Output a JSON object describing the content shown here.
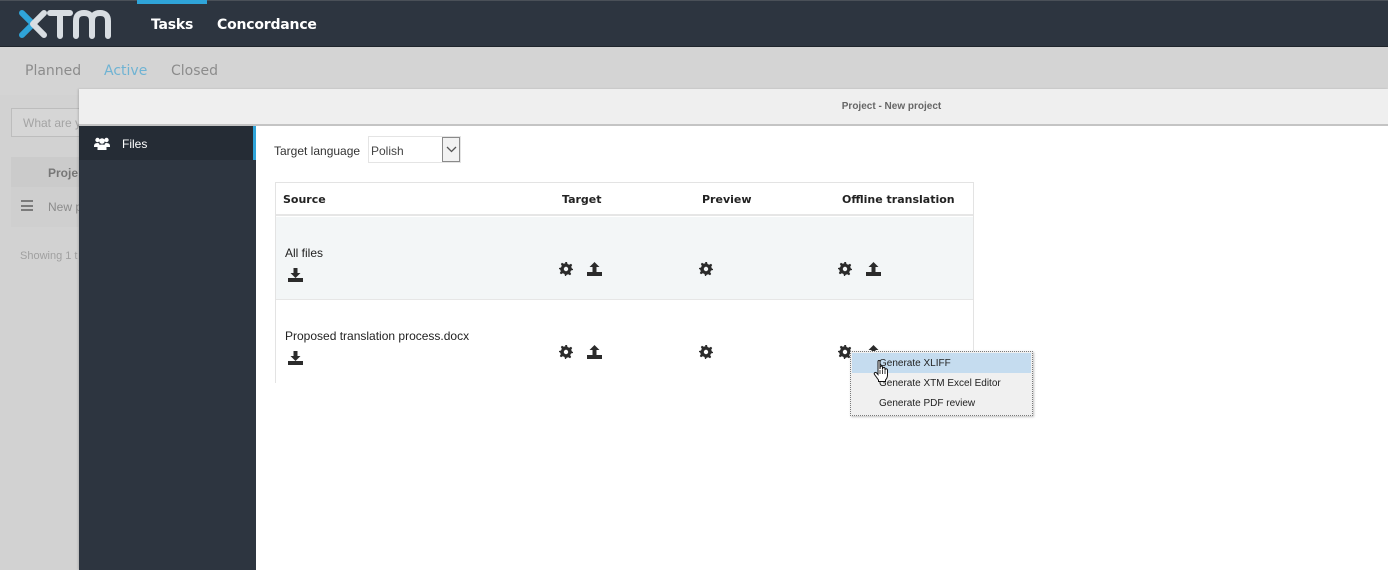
{
  "app": {
    "logo_text": "XTM",
    "colors": {
      "accent": "#2fa4d9",
      "topbar": "#2d3540",
      "sidebar": "#2d3540",
      "menu_highlight": "#c5dcef"
    }
  },
  "topnav": {
    "tabs": [
      {
        "label": "Tasks",
        "active": true
      },
      {
        "label": "Concordance",
        "active": false
      }
    ]
  },
  "subnav": {
    "tabs": [
      {
        "label": "Planned",
        "active": false
      },
      {
        "label": "Active",
        "active": true
      },
      {
        "label": "Closed",
        "active": false
      }
    ]
  },
  "background_page": {
    "search_placeholder": "What are y",
    "table_header": "Proje",
    "row_name": "New p",
    "showing_text": "Showing 1 t"
  },
  "modal": {
    "title": "Project - New project",
    "sidebar": {
      "items": [
        {
          "label": "Files",
          "icon": "users-icon",
          "active": true
        }
      ]
    },
    "target_language": {
      "label": "Target language",
      "value": "Polish"
    },
    "files_table": {
      "columns": [
        "Source",
        "Target",
        "Preview",
        "Offline translation"
      ],
      "rows": [
        {
          "name": "All files"
        },
        {
          "name": "Proposed translation process.docx"
        }
      ]
    },
    "context_menu": {
      "items": [
        {
          "label": "Generate XLIFF",
          "highlighted": true
        },
        {
          "label": "Generate XTM Excel Editor",
          "highlighted": false
        },
        {
          "label": "Generate PDF review",
          "highlighted": false
        }
      ]
    }
  }
}
